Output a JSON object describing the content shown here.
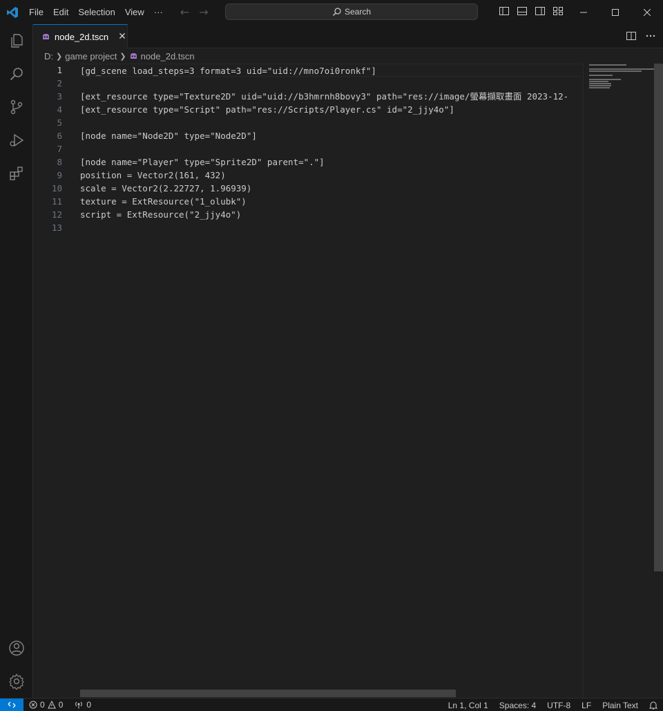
{
  "menu": [
    "File",
    "Edit",
    "Selection",
    "View",
    "···"
  ],
  "search": {
    "label": "Search"
  },
  "tab": {
    "label": "node_2d.tscn",
    "close": "✕"
  },
  "breadcrumb": {
    "drive": "D:",
    "folder": "game project",
    "file": "node_2d.tscn"
  },
  "editor": {
    "line_numbers": [
      "1",
      "2",
      "3",
      "4",
      "5",
      "6",
      "7",
      "8",
      "9",
      "10",
      "11",
      "12",
      "13"
    ],
    "lines": [
      "[gd_scene load_steps=3 format=3 uid=\"uid://mno7oi0ronkf\"]",
      "",
      "[ext_resource type=\"Texture2D\" uid=\"uid://b3hmrnh8bovy3\" path=\"res://image/螢幕擷取畫面 2023-12-",
      "[ext_resource type=\"Script\" path=\"res://Scripts/Player.cs\" id=\"2_jjy4o\"]",
      "",
      "[node name=\"Node2D\" type=\"Node2D\"]",
      "",
      "[node name=\"Player\" type=\"Sprite2D\" parent=\".\"]",
      "position = Vector2(161, 432)",
      "scale = Vector2(2.22727, 1.96939)",
      "texture = ExtResource(\"1_olubk\")",
      "script = ExtResource(\"2_jjy4o\")",
      ""
    ]
  },
  "status": {
    "errors": "0",
    "warnings": "0",
    "ports": "0",
    "position": "Ln 1, Col 1",
    "spaces": "Spaces: 4",
    "encoding": "UTF-8",
    "eol": "LF",
    "language": "Plain Text"
  },
  "colors": {
    "accent": "#0078d4",
    "background": "#1f1f1f",
    "chrome": "#181818"
  },
  "icons": [
    "vscode-logo-icon",
    "explorer-icon",
    "search-icon",
    "source-control-icon",
    "run-debug-icon",
    "extensions-icon",
    "account-icon",
    "manage-gear-icon",
    "split-editor-icon",
    "more-actions-icon",
    "godot-file-icon",
    "bell-icon",
    "remote-icon"
  ]
}
